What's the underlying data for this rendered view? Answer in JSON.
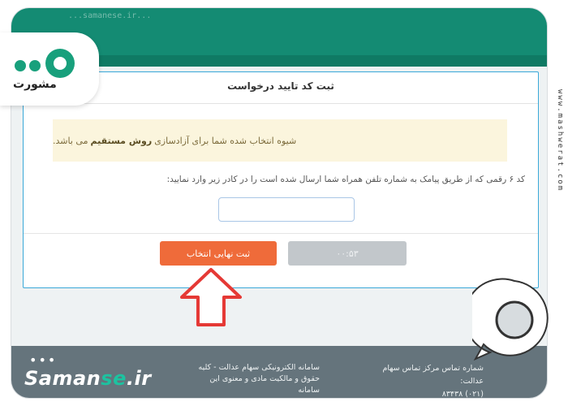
{
  "page": {
    "url_text": "...samanese.ir..."
  },
  "card": {
    "title": "ثبت کد تایید درخواست",
    "notice_prefix": "شیوه انتخاب شده شما برای آزادسازی",
    "notice_bold": "روش مستقیم",
    "notice_suffix": "می باشد.",
    "instruction": "کد ۶ رقمی که از طریق پیامک به شماره تلفن همراه شما ارسال شده است را در کادر زیر وارد نمایید:",
    "code_input_value": "",
    "submit_label": "ثبت نهایی انتخاب",
    "timer_label": "۰۰:۵۳"
  },
  "footer": {
    "brand_main": "Saman",
    "brand_accent": "se",
    "brand_tld": ".ir",
    "description": "سامانه الکترونیکی سهام عدالت - کلیه حقوق و مالکیت مادی و معنوی این سامانه",
    "contact_label": "شماره تماس مرکز تماس سهام عدالت:",
    "contact_number": "(۰۲۱) ۸۳۴۳۸"
  },
  "overlays": {
    "logo_text": "مشورت",
    "watermark": "www.mashwerat.com"
  },
  "colors": {
    "header_green": "#148b73",
    "accent_orange": "#ef6b3a",
    "card_border_blue": "#3aa8d8",
    "notice_bg": "#fbf5dd",
    "footer_gray": "#65747c",
    "brand_teal": "#1dc2a0",
    "arrow_red": "#e53935"
  }
}
